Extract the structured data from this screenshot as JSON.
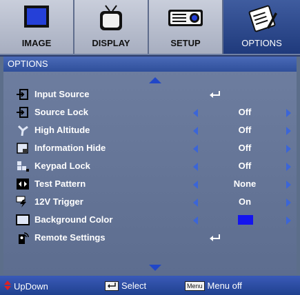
{
  "tabs": [
    {
      "label": "IMAGE",
      "icon": "monitor-icon"
    },
    {
      "label": "DISPLAY",
      "icon": "tv-icon"
    },
    {
      "label": "SETUP",
      "icon": "projector-icon"
    },
    {
      "label": "OPTIONS",
      "icon": "notepad-icon",
      "active": true
    }
  ],
  "panel": {
    "title": "OPTIONS",
    "items": [
      {
        "label": "Input Source",
        "icon": "input-source-icon",
        "value": "",
        "enter": true
      },
      {
        "label": "Source Lock",
        "icon": "source-lock-icon",
        "value": "Off"
      },
      {
        "label": "High Altitude",
        "icon": "fan-icon",
        "value": "Off"
      },
      {
        "label": "Information Hide",
        "icon": "info-hide-icon",
        "value": "Off"
      },
      {
        "label": "Keypad Lock",
        "icon": "keypad-icon",
        "value": "Off"
      },
      {
        "label": "Test Pattern",
        "icon": "test-pattern-icon",
        "value": "None"
      },
      {
        "label": "12V Trigger",
        "icon": "trigger-12v-icon",
        "value": "On"
      },
      {
        "label": "Background Color",
        "icon": "background-color-icon",
        "value": "",
        "color": "#1414ee"
      },
      {
        "label": "Remote Settings",
        "icon": "remote-icon",
        "value": "",
        "enter": true
      }
    ]
  },
  "footer": {
    "updown": "UpDown",
    "select": "Select",
    "menu_key": "Menu",
    "menu_off": "Menu off"
  },
  "colors": {
    "accent": "#2147c8",
    "panel": "#6e7ea0",
    "title_bar": "#3a5ab8"
  }
}
